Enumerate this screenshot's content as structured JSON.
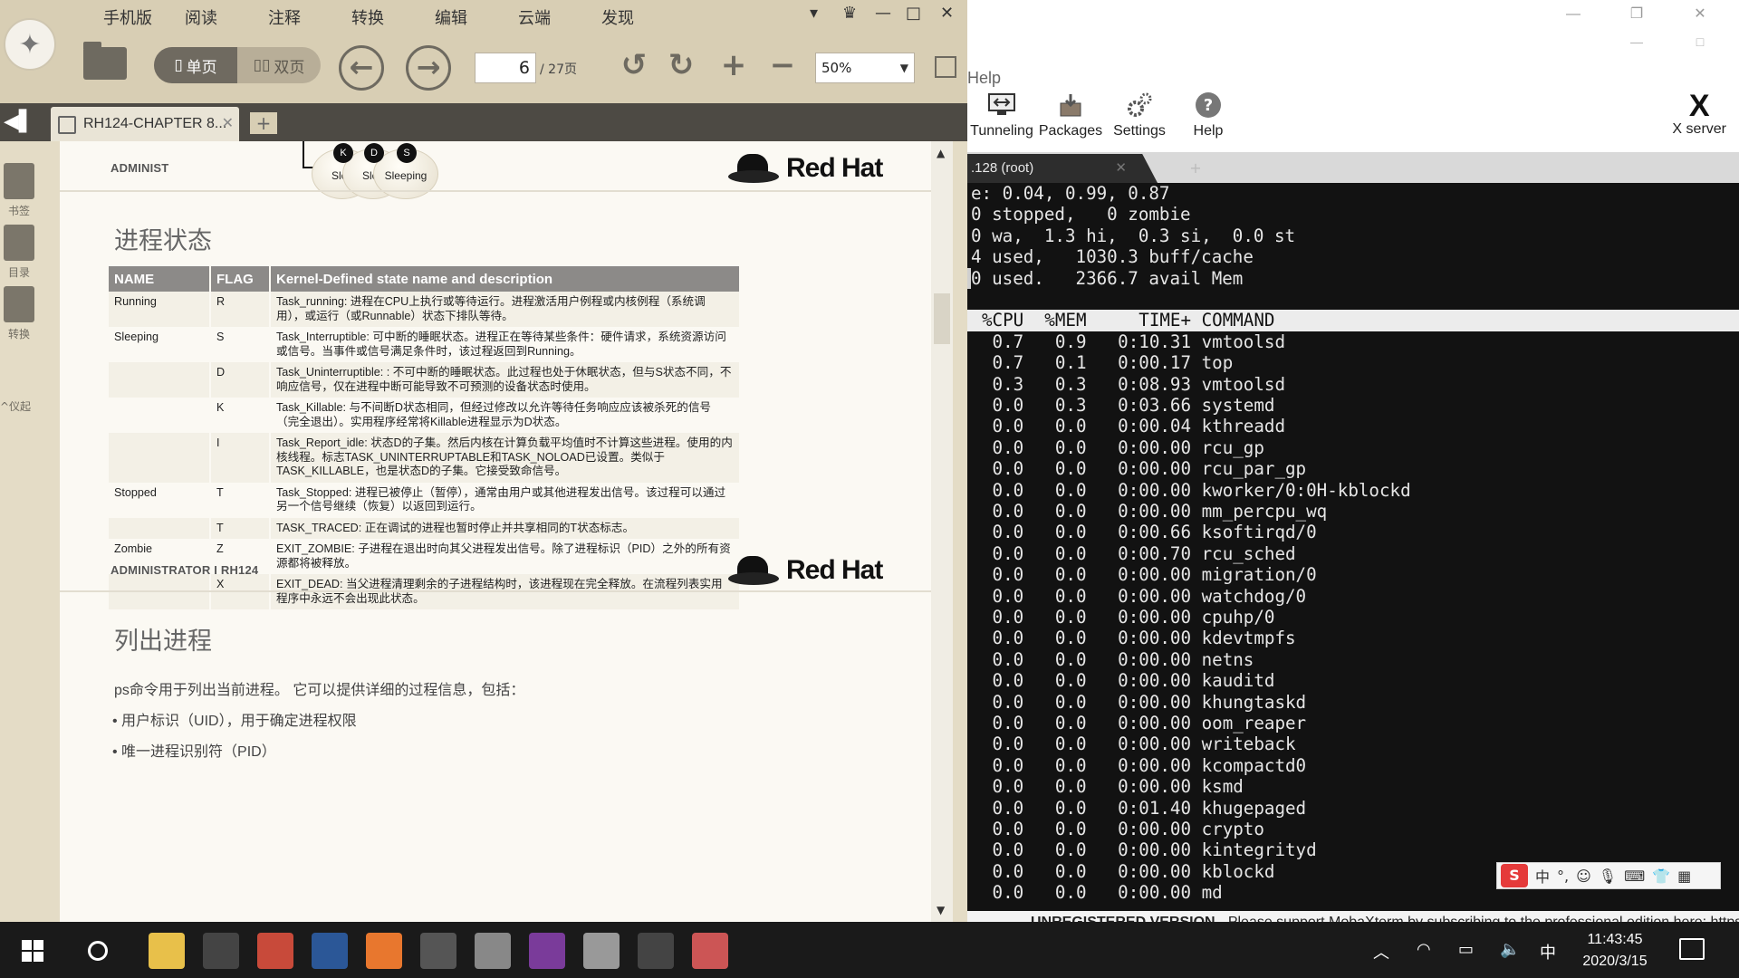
{
  "reader": {
    "menu": [
      "手机版",
      "阅读",
      "注释",
      "转换",
      "编辑",
      "云端",
      "发现"
    ],
    "view_single": "单页",
    "view_double": "双页",
    "current_page": "6",
    "total_pages": "/ 27页",
    "zoom": "50%",
    "tab_title": "RH124-CHAPTER 8...",
    "add_tab": "+",
    "sidebar": [
      "书签",
      "目录",
      "转换"
    ],
    "sidebar_extra": "^仪起"
  },
  "doc": {
    "bubbles": [
      {
        "dot": "K",
        "label": "Slee"
      },
      {
        "dot": "D",
        "label": "Slee"
      },
      {
        "dot": "S",
        "label": "Sleeping"
      }
    ],
    "header_admin": "ADMINIST",
    "brand": "Red Hat",
    "section1_title": "进程状态",
    "table_headers": [
      "NAME",
      "FLAG",
      "Kernel-Defined state name and description"
    ],
    "rows": [
      {
        "name": "Running",
        "flag": "R",
        "desc": "Task_running: 进程在CPU上执行或等待运行。进程激活用户例程或内核例程（系统调用），或运行（或Runnable）状态下排队等待。"
      },
      {
        "name": "Sleeping",
        "flag": "S",
        "desc": "Task_Interruptible: 可中断的睡眠状态。进程正在等待某些条件：硬件请求，系统资源访问或信号。当事件或信号满足条件时，该过程返回到Running。"
      },
      {
        "name": "",
        "flag": "D",
        "desc": "Task_Uninterruptible: : 不可中断的睡眠状态。此过程也处于休眠状态，但与S状态不同，不响应信号，仅在进程中断可能导致不可预测的设备状态时使用。"
      },
      {
        "name": "",
        "flag": "K",
        "desc": "Task_Killable: 与不间断D状态相同，但经过修改以允许等待任务响应应该被杀死的信号（完全退出）。实用程序经常将Killable进程显示为D状态。"
      },
      {
        "name": "",
        "flag": "I",
        "desc": "Task_Report_idle: 状态D的子集。然后内核在计算负载平均值时不计算这些进程。使用的内核线程。标志TASK_UNINTERRUPTABLE和TASK_NOLOAD已设置。类似于TASK_KILLABLE，也是状态D的子集。它接受致命信号。"
      },
      {
        "name": "Stopped",
        "flag": "T",
        "desc": "Task_Stopped: 进程已被停止（暂停），通常由用户或其他进程发出信号。该过程可以通过另一个信号继续（恢复）以返回到运行。"
      },
      {
        "name": "",
        "flag": "T",
        "desc": "TASK_TRACED: 正在调试的进程也暂时停止并共享相同的T状态标志。"
      },
      {
        "name": "Zombie",
        "flag": "Z",
        "desc": "EXIT_ZOMBIE: 子进程在退出时向其父进程发出信号。除了进程标识（PID）之外的所有资源都将被释放。"
      },
      {
        "name": "",
        "flag": "X",
        "desc": "EXIT_DEAD: 当父进程清理剩余的子进程结构时，该进程现在完全释放。在流程列表实用程序中永远不会出现此状态。"
      }
    ],
    "footer_admin": "ADMINISTRATOR I RH124",
    "section2_title": "列出进程",
    "para": "ps命令用于列出当前进程。 它可以提供详细的过程信息，包括：",
    "bullets": [
      "•  用户标识（UID），用于确定进程权限",
      "•  唯一进程识别符（PID）"
    ]
  },
  "moba": {
    "menu_help": "Help",
    "tools": [
      "Tunneling",
      "Packages",
      "Settings",
      "Help"
    ],
    "xserver": "X server",
    "session_tab": ".128 (root)",
    "status_bar": {
      "unregistered": "UNREGISTERED VERSION",
      "message": "  -  Please support MobaXterm by subscribing to the professional edition here:  https://mobaxterm.mobatek.net"
    }
  },
  "terminal": {
    "summary": [
      "e: 0.04, 0.99, 0.87",
      "0 stopped,   0 zombie",
      "0 wa,  1.3 hi,  0.3 si,  0.0 st",
      "4 used,   1030.3 buff/cache",
      "0 used.   2366.7 avail Mem"
    ],
    "header": "%CPU  %MEM     TIME+ COMMAND",
    "procs": [
      [
        "0.7",
        "0.9",
        "0:10.31",
        "vmtoolsd"
      ],
      [
        "0.7",
        "0.1",
        "0:00.17",
        "top"
      ],
      [
        "0.3",
        "0.3",
        "0:08.93",
        "vmtoolsd"
      ],
      [
        "0.0",
        "0.3",
        "0:03.66",
        "systemd"
      ],
      [
        "0.0",
        "0.0",
        "0:00.04",
        "kthreadd"
      ],
      [
        "0.0",
        "0.0",
        "0:00.00",
        "rcu_gp"
      ],
      [
        "0.0",
        "0.0",
        "0:00.00",
        "rcu_par_gp"
      ],
      [
        "0.0",
        "0.0",
        "0:00.00",
        "kworker/0:0H-kblockd"
      ],
      [
        "0.0",
        "0.0",
        "0:00.00",
        "mm_percpu_wq"
      ],
      [
        "0.0",
        "0.0",
        "0:00.66",
        "ksoftirqd/0"
      ],
      [
        "0.0",
        "0.0",
        "0:00.70",
        "rcu_sched"
      ],
      [
        "0.0",
        "0.0",
        "0:00.00",
        "migration/0"
      ],
      [
        "0.0",
        "0.0",
        "0:00.00",
        "watchdog/0"
      ],
      [
        "0.0",
        "0.0",
        "0:00.00",
        "cpuhp/0"
      ],
      [
        "0.0",
        "0.0",
        "0:00.00",
        "kdevtmpfs"
      ],
      [
        "0.0",
        "0.0",
        "0:00.00",
        "netns"
      ],
      [
        "0.0",
        "0.0",
        "0:00.00",
        "kauditd"
      ],
      [
        "0.0",
        "0.0",
        "0:00.00",
        "khungtaskd"
      ],
      [
        "0.0",
        "0.0",
        "0:00.00",
        "oom_reaper"
      ],
      [
        "0.0",
        "0.0",
        "0:00.00",
        "writeback"
      ],
      [
        "0.0",
        "0.0",
        "0:00.00",
        "kcompactd0"
      ],
      [
        "0.0",
        "0.0",
        "0:00.00",
        "ksmd"
      ],
      [
        "0.0",
        "0.0",
        "0:01.40",
        "khugepaged"
      ],
      [
        "0.0",
        "0.0",
        "0:00.00",
        "crypto"
      ],
      [
        "0.0",
        "0.0",
        "0:00.00",
        "kintegrityd"
      ],
      [
        "0.0",
        "0.0",
        "0:00.00",
        "kblockd"
      ],
      [
        "0.0",
        "0.0",
        "0:00.00",
        "md"
      ]
    ]
  },
  "ime": {
    "logo": "S",
    "lang": "中",
    "punct": "°,",
    "icons": [
      "smile-icon",
      "mic-icon",
      "keyboard-icon",
      "shirt-icon",
      "grid-icon"
    ]
  },
  "taskbar": {
    "apps": [
      "file-explorer-icon",
      "circle-app-icon",
      "pdf-reader-icon",
      "word-icon",
      "firefox-icon",
      "camera-app-icon",
      "vmware-icon",
      "onenote-icon",
      "feather-app-icon",
      "mobaxterm-icon",
      "paint-icon"
    ],
    "tray_lang": "中",
    "time": "11:43:45",
    "date": "2020/3/15"
  },
  "colors": {
    "reader_toolbar": "#d8ceb4",
    "terminal_bg": "#121212",
    "table_header": "#8c8a88"
  }
}
